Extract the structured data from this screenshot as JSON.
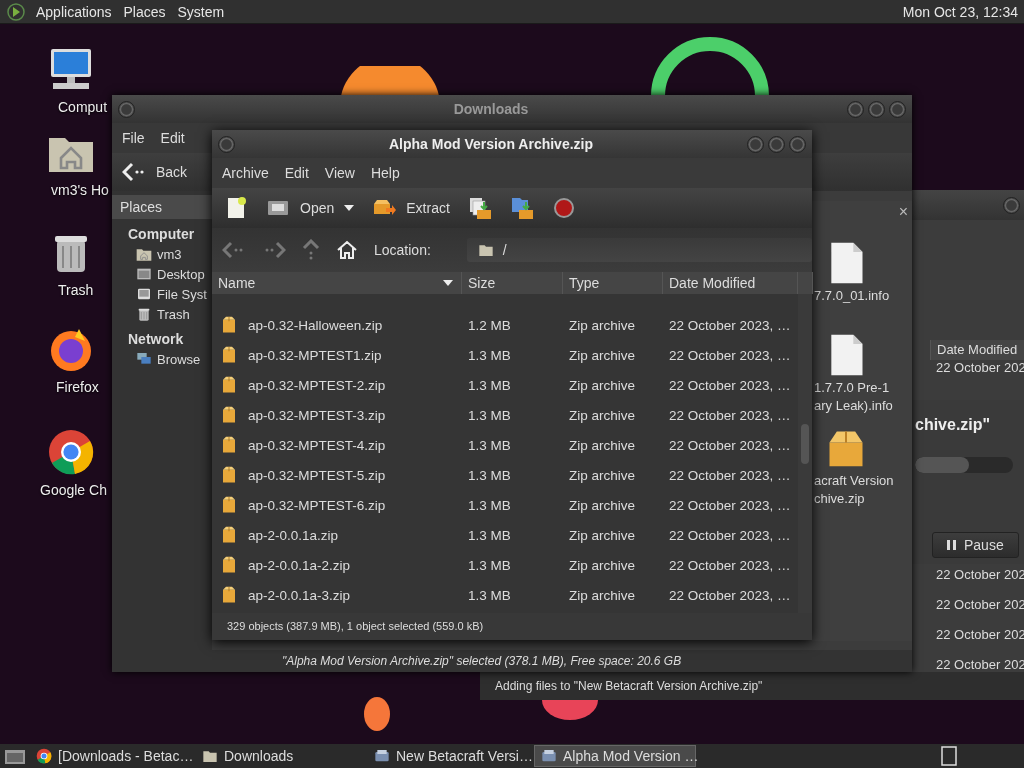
{
  "top_panel": {
    "menus": [
      "Applications",
      "Places",
      "System"
    ],
    "clock": "Mon Oct 23, 12:34"
  },
  "desktop_icons": [
    {
      "label": "Comput",
      "kind": "computer"
    },
    {
      "label": "vm3's Ho",
      "kind": "home"
    },
    {
      "label": "Trash",
      "kind": "trash"
    },
    {
      "label": "Firefox",
      "kind": "firefox"
    },
    {
      "label": "Google Ch",
      "kind": "chrome"
    }
  ],
  "downloads_window": {
    "title": "Downloads",
    "menu": [
      "File",
      "Edit"
    ],
    "back": "Back",
    "sidebar": {
      "title": "Places",
      "sections": [
        {
          "heading": "Computer",
          "items": [
            {
              "label": "vm3",
              "kind": "home"
            },
            {
              "label": "Desktop",
              "kind": "desktop"
            },
            {
              "label": "File Syst",
              "kind": "drive"
            },
            {
              "label": "Trash",
              "kind": "trash"
            }
          ]
        },
        {
          "heading": "Network",
          "items": [
            {
              "label": "Browse",
              "kind": "network"
            }
          ]
        }
      ]
    },
    "pane_close": "×",
    "files": [
      {
        "lines": [
          "7.7.0_01.info"
        ],
        "kind": "document"
      },
      {
        "lines": [
          "1.7.7.0 Pre-1",
          "ary Leak).info"
        ],
        "kind": "document"
      },
      {
        "lines": [
          "acraft Version",
          "chive.zip"
        ],
        "kind": "archive"
      }
    ],
    "status": "\"Alpha Mod Version Archive.zip\" selected (378.1 MB), Free space: 20.6 GB"
  },
  "background_window": {
    "column_header": "Date Modified",
    "dates_top": [
      "22 October 202"
    ],
    "dates_bottom": [
      "22 October 202",
      "22 October 202",
      "22 October 202",
      "22 October 202"
    ],
    "status": "Adding files to \"New Betacraft Version Archive.zip\""
  },
  "progress_dialog": {
    "heading": "chive.zip\"",
    "level": 0.55,
    "pause": "Pause"
  },
  "archive_window": {
    "title": "Alpha Mod Version Archive.zip",
    "menu": [
      "Archive",
      "Edit",
      "View",
      "Help"
    ],
    "toolbar": [
      {
        "kind": "new"
      },
      {
        "kind": "open",
        "label": "Open"
      },
      {
        "kind": "extract",
        "label": "Extract"
      },
      {
        "kind": "add-files"
      },
      {
        "kind": "add-folder"
      },
      {
        "kind": "stop"
      }
    ],
    "location_label": "Location:",
    "location": "/",
    "columns": [
      "Name",
      "Size",
      "Type",
      "Date Modified"
    ],
    "rows": [
      {
        "name": "ap-0.32-Halloween.zip",
        "size": "1.2 MB",
        "type": "Zip archive",
        "date": "22 October 2023, …"
      },
      {
        "name": "ap-0.32-MPTEST1.zip",
        "size": "1.3 MB",
        "type": "Zip archive",
        "date": "22 October 2023, …"
      },
      {
        "name": "ap-0.32-MPTEST-2.zip",
        "size": "1.3 MB",
        "type": "Zip archive",
        "date": "22 October 2023, …"
      },
      {
        "name": "ap-0.32-MPTEST-3.zip",
        "size": "1.3 MB",
        "type": "Zip archive",
        "date": "22 October 2023, …"
      },
      {
        "name": "ap-0.32-MPTEST-4.zip",
        "size": "1.3 MB",
        "type": "Zip archive",
        "date": "22 October 2023, …"
      },
      {
        "name": "ap-0.32-MPTEST-5.zip",
        "size": "1.3 MB",
        "type": "Zip archive",
        "date": "22 October 2023, …"
      },
      {
        "name": "ap-0.32-MPTEST-6.zip",
        "size": "1.3 MB",
        "type": "Zip archive",
        "date": "22 October 2023, …"
      },
      {
        "name": "ap-2-0.0.1a.zip",
        "size": "1.3 MB",
        "type": "Zip archive",
        "date": "22 October 2023, …"
      },
      {
        "name": "ap-2-0.0.1a-2.zip",
        "size": "1.3 MB",
        "type": "Zip archive",
        "date": "22 October 2023, …"
      },
      {
        "name": "ap-2-0.0.1a-3.zip",
        "size": "1.3 MB",
        "type": "Zip archive",
        "date": "22 October 2023, …"
      }
    ],
    "status": "329 objects (387.9 MB), 1 object selected (559.0 kB)"
  },
  "taskbar": [
    {
      "label": "[Downloads - Betac…",
      "kind": "chrome",
      "selected": false
    },
    {
      "label": "Downloads",
      "kind": "folder",
      "selected": false
    },
    {
      "label": "New Betacraft Versi…",
      "kind": "archiver",
      "selected": false
    },
    {
      "label": "Alpha Mod Version …",
      "kind": "archiver",
      "selected": true
    }
  ]
}
